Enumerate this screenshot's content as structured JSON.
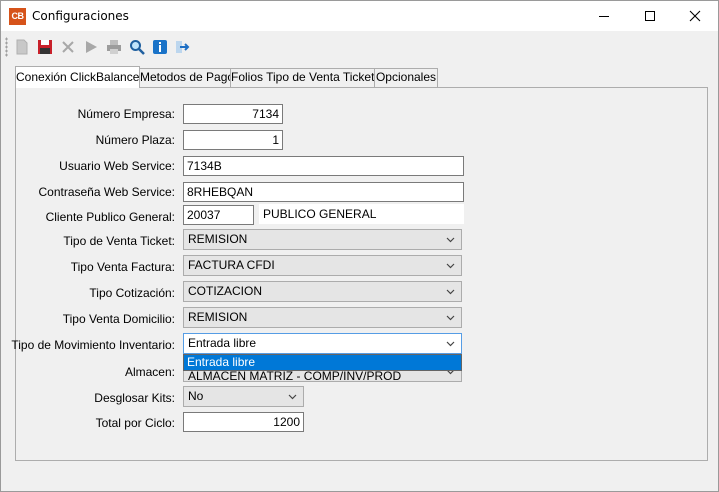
{
  "window": {
    "title": "Configuraciones",
    "app_icon_text": "CB"
  },
  "toolbar": {
    "buttons": [
      "new-icon",
      "save-icon",
      "delete-icon",
      "run-icon",
      "print-icon",
      "search-icon",
      "info-icon",
      "exit-icon"
    ]
  },
  "tabs": [
    {
      "label": "Conexión ClickBalance",
      "active": true
    },
    {
      "label": "Metodos de Pago",
      "active": false
    },
    {
      "label": "Folios Tipo de Venta Ticket",
      "active": false
    },
    {
      "label": "Opcionales",
      "active": false
    }
  ],
  "form": {
    "numero_empresa": {
      "label": "Número Empresa:",
      "value": "7134"
    },
    "numero_plaza": {
      "label": "Número Plaza:",
      "value": "1"
    },
    "usuario_ws": {
      "label": "Usuario Web Service:",
      "value": "7134B"
    },
    "contrasena_ws": {
      "label": "Contraseña Web Service:",
      "value": "8RHEBQAN"
    },
    "cliente_publico": {
      "label": "Cliente Publico General:",
      "value": "20037",
      "name": "PUBLICO GENERAL"
    },
    "tipo_venta_ticket": {
      "label": "Tipo de Venta Ticket:",
      "value": "REMISION"
    },
    "tipo_venta_factura": {
      "label": "Tipo Venta Factura:",
      "value": "FACTURA CFDI"
    },
    "tipo_cotizacion": {
      "label": "Tipo Cotización:",
      "value": "COTIZACION"
    },
    "tipo_venta_domicilio": {
      "label": "Tipo Venta Domicilio:",
      "value": "REMISION"
    },
    "tipo_mov_inventario": {
      "label": "Tipo de Movimiento Inventario:",
      "value": "Entrada libre",
      "options": [
        "Entrada libre"
      ]
    },
    "almacen": {
      "label": "Almacen:",
      "value": "ALMACEN MATRIZ - COMP/INV/PROD"
    },
    "desglosar_kits": {
      "label": "Desglosar Kits:",
      "value": "No"
    },
    "total_ciclo": {
      "label": "Total por Ciclo:",
      "value": "1200"
    }
  }
}
